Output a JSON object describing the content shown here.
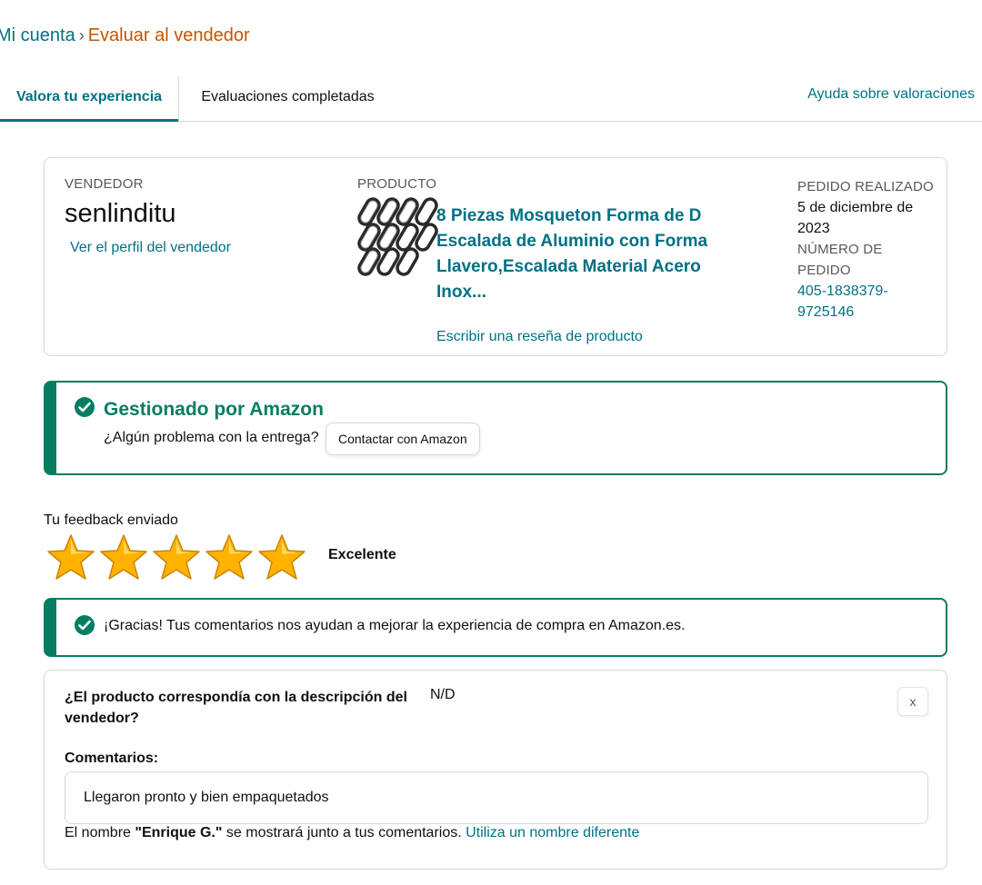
{
  "breadcrumb": {
    "parent": "Mi cuenta",
    "separator": "›",
    "current": "Evaluar al vendedor"
  },
  "tabs": [
    {
      "label": "Valora tu experiencia",
      "active": true
    },
    {
      "label": "Evaluaciones completadas",
      "active": false
    }
  ],
  "help_link": "Ayuda sobre valoraciones",
  "seller": {
    "label": "VENDEDOR",
    "name": "senlinditu",
    "profile_link": "Ver el perfil del vendedor"
  },
  "product": {
    "label": "PRODUCTO",
    "image_icon": "carabiner-image",
    "title": "8 Piezas Mosqueton Forma de D Escalada de Aluminio con Forma Llavero,Escalada Material Acero Inox...",
    "review_link": "Escribir una reseña de producto"
  },
  "order": {
    "placed_label": "PEDIDO REALIZADO",
    "placed_date": "5 de diciembre de 2023",
    "number_label": "NÚMERO DE PEDIDO",
    "number": "405-1838379-9725146"
  },
  "fulfillment": {
    "title": "Gestionado por Amazon",
    "question": "¿Algún problema con la entrega?",
    "contact_button": "Contactar con Amazon"
  },
  "feedback": {
    "label": "Tu feedback enviado",
    "rating": 5,
    "max_rating": 5,
    "rating_text": "Excelente"
  },
  "thanks_message": "¡Gracias! Tus comentarios nos ayudan a mejorar la experiencia de compra en Amazon.es.",
  "comment_section": {
    "question": "¿El producto correspondía con la descripción del vendedor?",
    "answer": "N/D",
    "close_label": "x",
    "comments_label": "Comentarios:",
    "comments_value": "Llegaron pronto y bien empaquetados",
    "name_note_prefix": "El nombre ",
    "name_note_name": "\"Enrique G.\"",
    "name_note_suffix": " se mostrará junto a tus comentarios. ",
    "name_note_link": "Utiliza un nombre diferente"
  },
  "colors": {
    "link": "#007185",
    "breadcrumb_current": "#c45500",
    "success": "#067d62",
    "star": "#ffa41c"
  }
}
